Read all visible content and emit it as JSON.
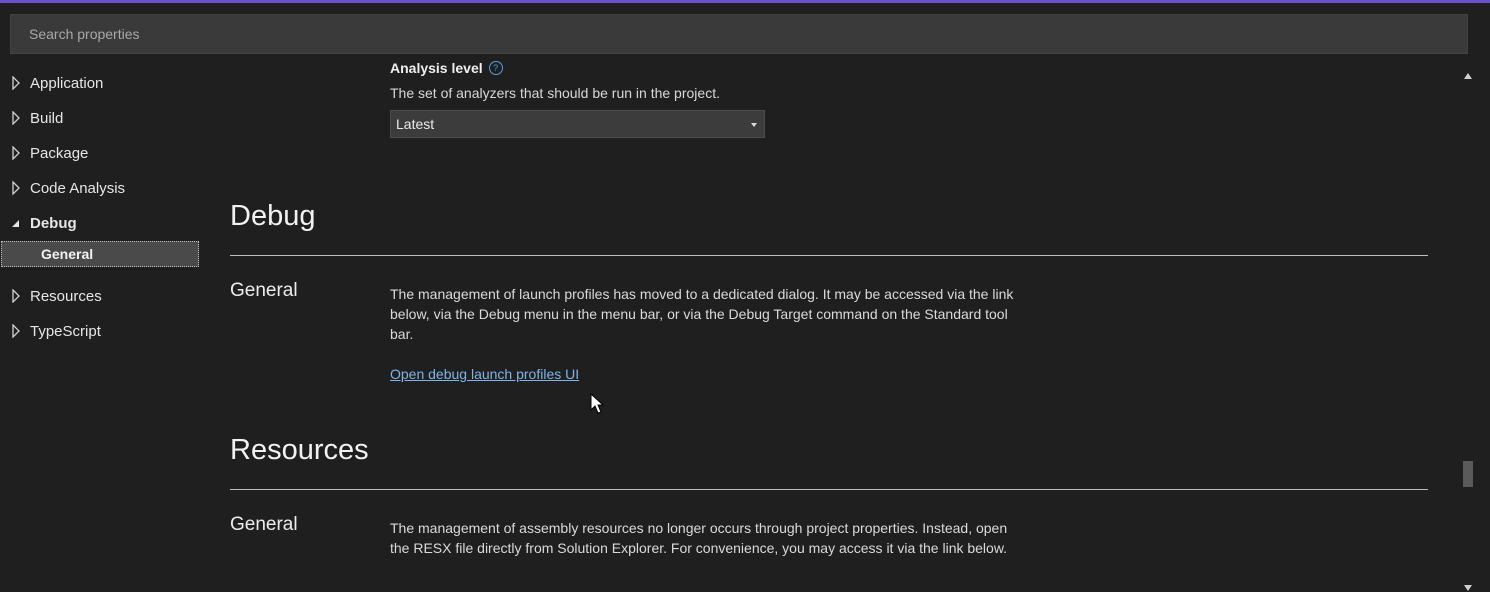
{
  "search": {
    "placeholder": "Search properties"
  },
  "sidebar": {
    "items": [
      {
        "label": "Application",
        "expanded": false
      },
      {
        "label": "Build",
        "expanded": false
      },
      {
        "label": "Package",
        "expanded": false
      },
      {
        "label": "Code Analysis",
        "expanded": false
      },
      {
        "label": "Debug",
        "expanded": true
      },
      {
        "label": "Resources",
        "expanded": false
      },
      {
        "label": "TypeScript",
        "expanded": false
      }
    ],
    "debug_sub": {
      "label": "General",
      "selected": true
    }
  },
  "analysis": {
    "title": "Analysis level",
    "help_icon": "?",
    "description": "The set of analyzers that should be run in the project.",
    "selected_value": "Latest"
  },
  "debug": {
    "title": "Debug",
    "group": "General",
    "body": "The management of launch profiles has moved to a dedicated dialog. It may be accessed via the link below, via the Debug menu in the menu bar, or via the Debug Target command on the Standard tool bar.",
    "link": "Open debug launch profiles UI"
  },
  "resources": {
    "title": "Resources",
    "group": "General",
    "body": "The management of assembly resources no longer occurs through project properties. Instead, open the RESX file directly from Solution Explorer. For convenience, you may access it via the link below."
  },
  "colors": {
    "background": "#1f1f1f",
    "accent": "#6a4fd1",
    "link": "#7fb4e8",
    "selected_nav": "#4a4a4a"
  }
}
